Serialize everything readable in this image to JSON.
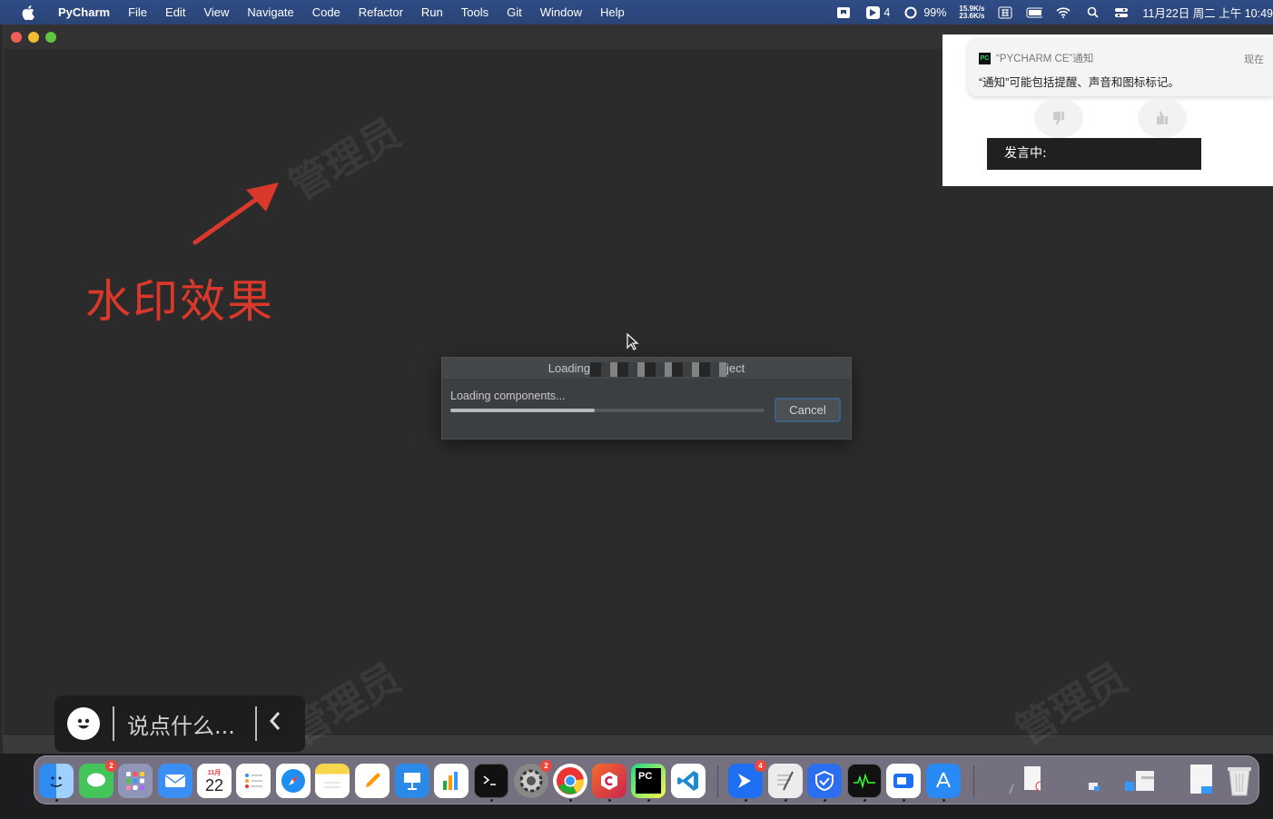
{
  "menubar": {
    "app_name": "PyCharm",
    "menus": [
      "File",
      "Edit",
      "View",
      "Navigate",
      "Code",
      "Refactor",
      "Run",
      "Tools",
      "Git",
      "Window",
      "Help"
    ],
    "status_count": "4",
    "battery_percent": "99%",
    "net_up": "15.9K/s",
    "net_down": "23.6K/s",
    "clock": "11月22日 周二 上午 10:49"
  },
  "watermark": {
    "text": "管理员"
  },
  "annotation": {
    "text": "水印效果",
    "color": "#d9382b"
  },
  "dialog": {
    "title_prefix": "Loading",
    "title_suffix": "ject",
    "status": "Loading components...",
    "progress": 0.46,
    "cancel_label": "Cancel"
  },
  "notification": {
    "app": "“PYCHARM CE”通知",
    "time": "现在",
    "body": "“通知”可能包括提醒、声音和图标标记。",
    "speaking_label": "发言中:"
  },
  "chat": {
    "placeholder": "说点什么..."
  },
  "dock": {
    "calendar_month": "11月",
    "calendar_day": "22",
    "pycharm_label": "PC",
    "badges": {
      "messages": "2",
      "settings": "2",
      "bluebird": "4"
    }
  },
  "colors": {
    "accent_blue": "#3d6185",
    "menubar": "#2f4c86",
    "window_bg": "#2b2b2b"
  }
}
